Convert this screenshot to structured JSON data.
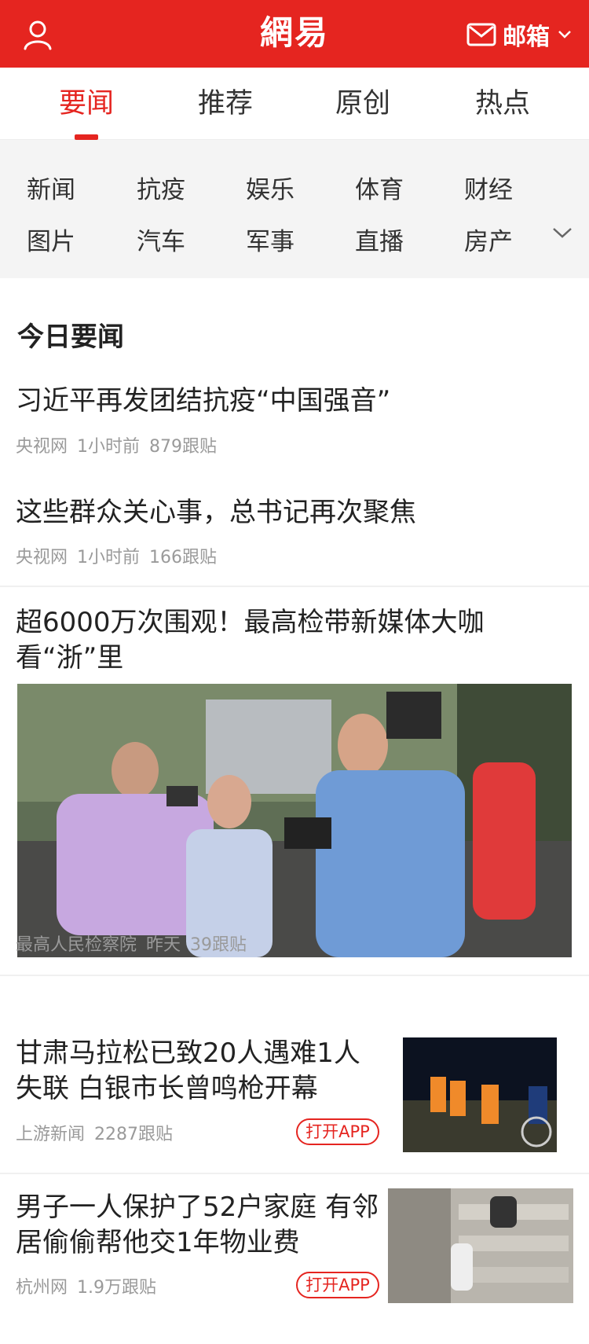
{
  "header": {
    "logo_text": "網易",
    "mail_label": "邮箱",
    "brand_color": "#e52520"
  },
  "tabs": [
    {
      "label": "要闻",
      "active": true
    },
    {
      "label": "推荐",
      "active": false
    },
    {
      "label": "原创",
      "active": false
    },
    {
      "label": "热点",
      "active": false
    }
  ],
  "channels": [
    "新闻",
    "抗疫",
    "娱乐",
    "体育",
    "财经",
    "图片",
    "汽车",
    "军事",
    "直播",
    "房产"
  ],
  "feed": {
    "section_title": "今日要闻",
    "items": [
      {
        "title": "习近平再发团结抗疫“中国强音”",
        "source": "央视网",
        "time": "1小时前",
        "comments": "879跟贴"
      },
      {
        "title": "这些群众关心事，总书记再次聚焦",
        "source": "央视网",
        "time": "1小时前",
        "comments": "166跟贴"
      },
      {
        "title_line1": "超6000万次围观！最高检带新媒体大咖",
        "title_line2": "看“浙”里",
        "source": "最高人民检察院",
        "time": "昨天",
        "comments": "39跟贴"
      },
      {
        "title_line1": "甘肃马拉松已致20人遇难1人",
        "title_line2": "失联 白银市长曾鸣枪开幕",
        "source": "上游新闻",
        "comments": "2287跟贴",
        "button": "打开APP"
      },
      {
        "title_line1": "男子一人保护了52户家庭 有邻",
        "title_line2": "居偷偷帮他交1年物业费",
        "source": "杭州网",
        "comments": "1.9万跟贴",
        "button": "打开APP"
      }
    ]
  },
  "icons": {
    "user": "user-icon",
    "mail": "mail-icon",
    "caret": "chevron-down-icon",
    "expand": "chevron-down-icon"
  }
}
